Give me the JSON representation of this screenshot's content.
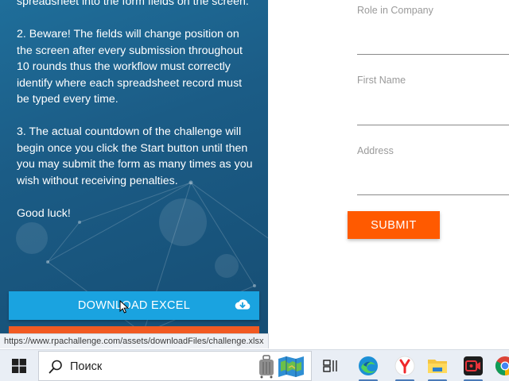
{
  "instructions": {
    "p1_tail": "spreadsheet into the form fields on the screen.",
    "p2": "2. Beware! The fields will change position on the screen after every submission throughout 10 rounds thus the workflow must correctly identify where each spreadsheet record must be typed every time.",
    "p3": "3. The actual countdown of the challenge will begin once you click the Start button until then you may submit the form as many times as you wish without receiving penalties.",
    "p4": "Good luck!"
  },
  "download_button": {
    "label": "DOWNLOAD EXCEL",
    "icon": "cloud-download-icon"
  },
  "form": {
    "fields": [
      {
        "label": "Role in Company",
        "value": ""
      },
      {
        "label": "First Name",
        "value": ""
      },
      {
        "label": "Address",
        "value": ""
      }
    ],
    "submit_label": "SUBMIT"
  },
  "status_bar": {
    "url": "https://www.rpachallenge.com/assets/downloadFiles/challenge.xlsx"
  },
  "taskbar": {
    "search_placeholder": "Поиск",
    "apps": [
      "task-view-icon",
      "edge-icon",
      "yandex-browser-icon",
      "file-explorer-icon",
      "screen-recorder-icon",
      "chrome-icon"
    ]
  },
  "colors": {
    "panel_blue": "#1b5c86",
    "download_blue": "#1aa3e0",
    "submit_orange": "#ff5a00"
  }
}
